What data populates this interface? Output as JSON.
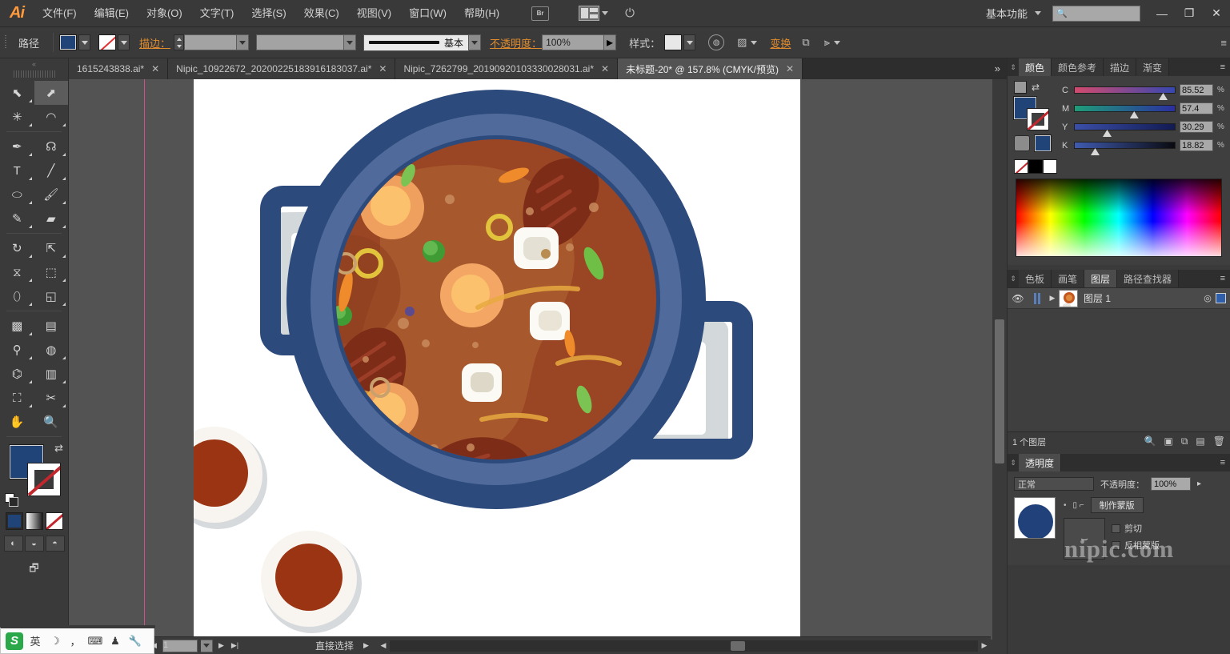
{
  "app": {
    "name": "Ai",
    "logo_color": "#ff9a3c"
  },
  "menu": {
    "items": [
      {
        "label": "文件(F)"
      },
      {
        "label": "编辑(E)"
      },
      {
        "label": "对象(O)"
      },
      {
        "label": "文字(T)"
      },
      {
        "label": "选择(S)"
      },
      {
        "label": "效果(C)"
      },
      {
        "label": "视图(V)"
      },
      {
        "label": "窗口(W)"
      },
      {
        "label": "帮助(H)"
      }
    ],
    "bridge_label": "Br",
    "workspace": "基本功能",
    "search_placeholder": "",
    "window_buttons": {
      "minimize": "—",
      "restore": "❐",
      "close": "✕"
    }
  },
  "control_bar": {
    "selection_label": "路径",
    "fill_color": "#204378",
    "stroke_color": "none",
    "stroke_label": "描边：",
    "stroke_weight": "",
    "stroke_profile": "",
    "brush_definition": "基本",
    "opacity_label": "不透明度：",
    "opacity_value": "100%",
    "style_label": "样式：",
    "style_swatch": "#e8e8e8",
    "icons": [
      "opacity-circle-icon",
      "document-setup-icon",
      "transform-icon",
      "align-icon",
      "distribute-icon"
    ],
    "transform_label": "变换",
    "panel_menu": "≡"
  },
  "tabs": {
    "items": [
      {
        "label": "1615243838.ai*",
        "active": false,
        "close": "✕"
      },
      {
        "label": "Nipic_10922672_20200225183916183037.ai*",
        "active": false,
        "close": "✕"
      },
      {
        "label": "Nipic_7262799_20190920103330028031.ai*",
        "active": false,
        "close": "✕"
      },
      {
        "label": "未标题-20* @ 157.8% (CMYK/预览)",
        "active": true,
        "close": "✕"
      }
    ],
    "overflow": "»"
  },
  "toolbar": {
    "tools": [
      {
        "name": "selection-tool",
        "glyph": "⬉",
        "selected": false
      },
      {
        "name": "direct-selection-tool",
        "glyph": "⬈",
        "selected": true
      },
      {
        "name": "magic-wand-tool",
        "glyph": "✷",
        "selected": false
      },
      {
        "name": "lasso-tool",
        "glyph": "➰",
        "selected": false
      },
      {
        "name": "pen-tool",
        "glyph": "✒",
        "selected": false
      },
      {
        "name": "curvature-tool",
        "glyph": "𝒞",
        "selected": false
      },
      {
        "name": "type-tool",
        "glyph": "T",
        "selected": false
      },
      {
        "name": "line-segment-tool",
        "glyph": "╱",
        "selected": false
      },
      {
        "name": "ellipse-tool",
        "glyph": "◯",
        "selected": false
      },
      {
        "name": "paintbrush-tool",
        "glyph": "🖌",
        "selected": false
      },
      {
        "name": "pencil-tool",
        "glyph": "✏",
        "selected": false
      },
      {
        "name": "eraser-tool",
        "glyph": "▰",
        "selected": false
      },
      {
        "name": "rotate-tool",
        "glyph": "↻",
        "selected": false
      },
      {
        "name": "scale-tool",
        "glyph": "⤢",
        "selected": false
      },
      {
        "name": "width-tool",
        "glyph": "⧗",
        "selected": false
      },
      {
        "name": "free-transform-tool",
        "glyph": "⬚",
        "selected": false
      },
      {
        "name": "shape-builder-tool",
        "glyph": "⬭",
        "selected": false
      },
      {
        "name": "perspective-grid-tool",
        "glyph": "◺",
        "selected": false
      },
      {
        "name": "mesh-tool",
        "glyph": "▩",
        "selected": false
      },
      {
        "name": "gradient-tool",
        "glyph": "▤",
        "selected": false
      },
      {
        "name": "eyedropper-tool",
        "glyph": "💧",
        "selected": false
      },
      {
        "name": "blend-tool",
        "glyph": "◍",
        "selected": false
      },
      {
        "name": "symbol-sprayer-tool",
        "glyph": "⌬",
        "selected": false
      },
      {
        "name": "column-graph-tool",
        "glyph": "▥",
        "selected": false
      },
      {
        "name": "artboard-tool",
        "glyph": "⛶",
        "selected": false
      },
      {
        "name": "slice-tool",
        "glyph": "✂",
        "selected": false
      },
      {
        "name": "hand-tool",
        "glyph": "✋",
        "selected": false
      },
      {
        "name": "zoom-tool",
        "glyph": "🔍",
        "selected": false
      }
    ],
    "fill_color": "#204378",
    "stroke_color": "#ffffff",
    "screen_mode_glyph": "🗗"
  },
  "canvas": {
    "background": "#535353",
    "artboard_color": "#ffffff",
    "guides_color": "#cf4f8a",
    "illustration": {
      "title": "top-view stew pot illustration",
      "pot_rim_color": "#2d4a7c",
      "pot_inner_rim_color": "#4a6596",
      "soup_color": "#9c4a25",
      "soup_highlight_color": "#a8572c",
      "shadow_color": "#d3d8db",
      "bowl_color": "#f6f2ed",
      "bowl_soup_color": "#9b3413"
    }
  },
  "status_bar": {
    "zoom_value": "157.8%",
    "page_value": "1",
    "tool_status": "直接选择"
  },
  "right_panel": {
    "color_panel": {
      "tabs": [
        {
          "label": "颜色",
          "active": true
        },
        {
          "label": "颜色参考",
          "active": false
        },
        {
          "label": "描边",
          "active": false
        },
        {
          "label": "渐变",
          "active": false
        }
      ],
      "menu": "≡",
      "mode": "CMYK",
      "channels": [
        {
          "label": "C",
          "value": "85.52",
          "unit": "%",
          "pos": 86
        },
        {
          "label": "M",
          "value": "57.4",
          "unit": "%",
          "pos": 57
        },
        {
          "label": "Y",
          "value": "30.29",
          "unit": "%",
          "pos": 30
        },
        {
          "label": "K",
          "value": "18.82",
          "unit": "%",
          "pos": 19
        }
      ],
      "fill_color": "#204378"
    },
    "layers_panel": {
      "tabs": [
        {
          "label": "色板",
          "active": false
        },
        {
          "label": "画笔",
          "active": false
        },
        {
          "label": "图层",
          "active": true
        },
        {
          "label": "路径查找器",
          "active": false
        }
      ],
      "menu": "≡",
      "rows": [
        {
          "name": "图层 1",
          "visible": true,
          "locked": false,
          "selected": true,
          "eye": "👁"
        }
      ],
      "footer_count": "1 个图层",
      "footer_icons": [
        "locate-object-icon",
        "make-clipping-mask-icon",
        "create-new-sublayer-icon",
        "create-new-layer-icon",
        "delete-selection-icon"
      ]
    },
    "transparency_panel": {
      "title": "透明度",
      "menu": "≡",
      "blend_mode": "正常",
      "opacity_label": "不透明度：",
      "opacity_value": "100%",
      "make_mask_label": "制作蒙版",
      "clip_label": "剪切",
      "invert_mask_label": "反相蒙版"
    },
    "watermark_text": "nipic.com"
  },
  "ime": {
    "logo": "S",
    "items": [
      {
        "name": "language-mode",
        "glyph": "英"
      },
      {
        "name": "moon-icon",
        "glyph": "☽"
      },
      {
        "name": "punctuation-icon",
        "glyph": "，"
      },
      {
        "name": "soft-keyboard-icon",
        "glyph": "⌨"
      },
      {
        "name": "user-icon",
        "glyph": "♟"
      },
      {
        "name": "toolbox-icon",
        "glyph": "🔧"
      }
    ]
  }
}
